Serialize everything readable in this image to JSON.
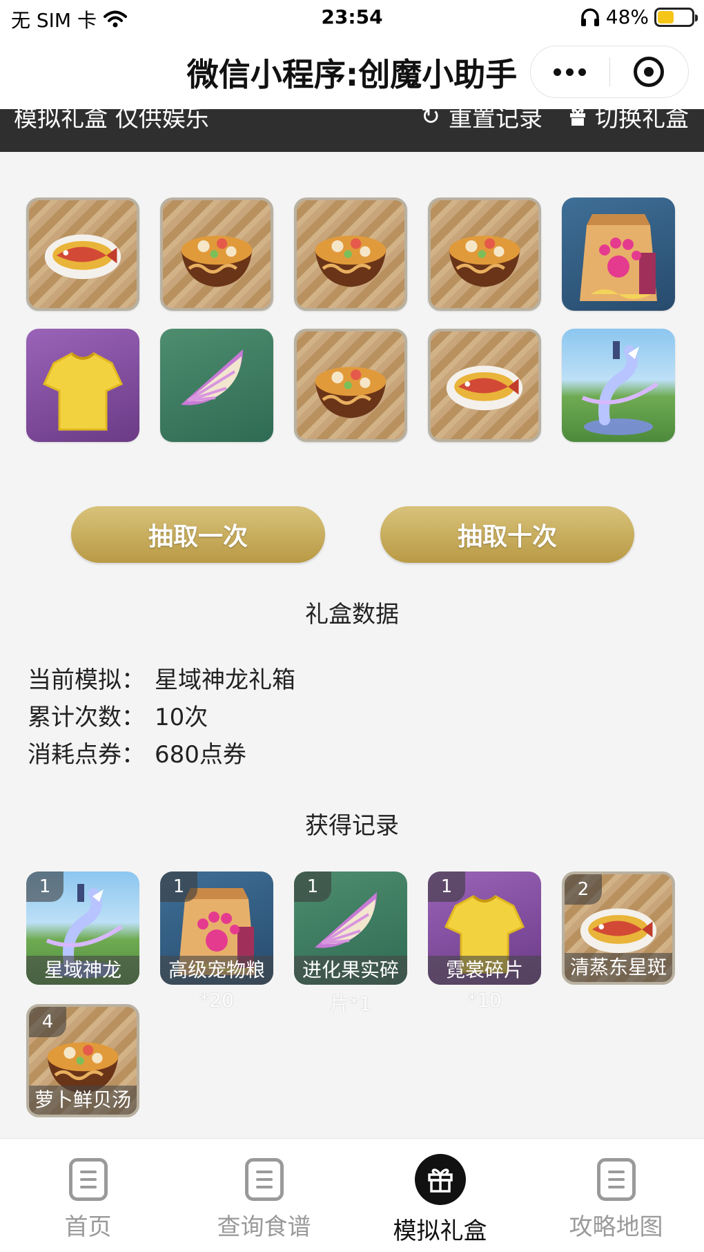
{
  "status_bar": {
    "carrier": "无 SIM 卡",
    "time": "23:54",
    "battery": "48%",
    "battery_level": 0.48
  },
  "titlebar": {
    "title": "微信小程序:创魔小助手"
  },
  "toolbar": {
    "left_text": "模拟礼盒 仅供娱乐",
    "reset_label": "重置记录",
    "switch_label": "切换礼盒"
  },
  "results": [
    {
      "item": "清蒸东星斑",
      "icon": "fish-dish-icon"
    },
    {
      "item": "萝卜鲜贝汤",
      "icon": "soup-bowl-icon"
    },
    {
      "item": "萝卜鲜贝汤",
      "icon": "soup-bowl-icon"
    },
    {
      "item": "萝卜鲜贝汤",
      "icon": "soup-bowl-icon"
    },
    {
      "item": "高级宠物粮",
      "icon": "pet-food-bag-icon"
    },
    {
      "item": "霓裳碎片",
      "icon": "shirt-icon"
    },
    {
      "item": "进化果实碎片",
      "icon": "fruit-slice-icon"
    },
    {
      "item": "萝卜鲜贝汤",
      "icon": "soup-bowl-icon"
    },
    {
      "item": "清蒸东星斑",
      "icon": "fish-dish-icon"
    },
    {
      "item": "星域神龙",
      "icon": "dragon-mount-icon"
    }
  ],
  "buttons": {
    "draw_once": "抽取一次",
    "draw_ten": "抽取十次"
  },
  "stats": {
    "section_title": "礼盒数据",
    "current_label": "当前模拟：",
    "current_value": "星域神龙礼箱",
    "count_label": "累计次数：",
    "count_value": "10次",
    "cost_label": "消耗点券：",
    "cost_value": "680点券"
  },
  "records": {
    "section_title": "获得记录",
    "items": [
      {
        "count": "1",
        "name": "星域神龙",
        "sub": "",
        "icon": "dragon-mount-icon"
      },
      {
        "count": "1",
        "name": "高级宠物粮",
        "sub": "*20",
        "icon": "pet-food-bag-icon"
      },
      {
        "count": "1",
        "name": "进化果实碎",
        "sub": "片*1",
        "icon": "fruit-slice-icon"
      },
      {
        "count": "1",
        "name": "霓裳碎片",
        "sub": "*10",
        "icon": "shirt-icon"
      },
      {
        "count": "2",
        "name": "清蒸东星斑",
        "sub": "",
        "icon": "fish-dish-icon"
      },
      {
        "count": "4",
        "name": "萝卜鲜贝汤",
        "sub": "",
        "icon": "soup-bowl-icon"
      }
    ]
  },
  "tabs": [
    {
      "label": "首页",
      "icon": "document-icon",
      "active": false
    },
    {
      "label": "查询食谱",
      "icon": "document-icon",
      "active": false
    },
    {
      "label": "模拟礼盒",
      "icon": "gift-icon",
      "active": true
    },
    {
      "label": "攻略地图",
      "icon": "document-icon",
      "active": false
    }
  ]
}
